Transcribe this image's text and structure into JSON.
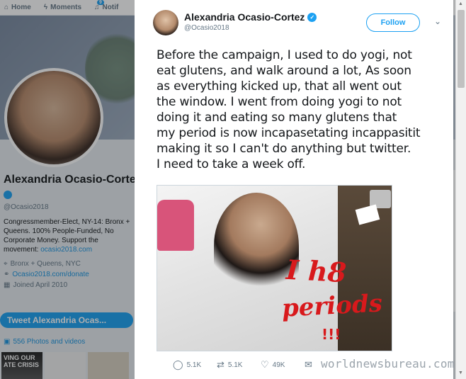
{
  "nav": {
    "home": "Home",
    "moments": "Moments",
    "notifications": "Notif",
    "notif_count": "9"
  },
  "profile": {
    "name": "Alexandria Ocasio-Cortez",
    "handle": "@Ocasio2018",
    "bio": "Congressmember-Elect, NY-14: Bronx + Queens. 100% People-Funded, No Corporate Money. Support the movement:",
    "bio_link": "ocasio2018.com",
    "location": "Bronx + Queens, NYC",
    "website": "Ocasio2018.com/donate",
    "joined": "Joined April 2010",
    "tweet_to_button": "Tweet Alexandria Ocas...",
    "photos_link": "556 Photos and videos",
    "thumb_text": "VING OUR ATE CRISIS"
  },
  "tweet": {
    "author_name": "Alexandria Ocasio-Cortez",
    "author_handle": "@Ocasio2018",
    "follow_label": "Follow",
    "lines": [
      "Before the campaign, I used to do yogi, not",
      "eat glutens, and walk around a lot, As soon",
      "as everything kicked up, that all went out",
      "the  window. I went from doing yogi to not",
      "doing it and eating so many glutens that",
      "my period is now incapasetating incappasitit",
      "making it so I can't do anything but twitter.",
      "I need to take a week off."
    ],
    "image_text_1": "I h8",
    "image_text_2": "periods",
    "image_text_3": "!!!",
    "replies": "5.1K",
    "retweets": "5.1K",
    "likes": "49K"
  },
  "watermark": "worldnewsbureau.com",
  "colors": {
    "accent": "#1da1f2",
    "ink_red": "#d8191c"
  }
}
